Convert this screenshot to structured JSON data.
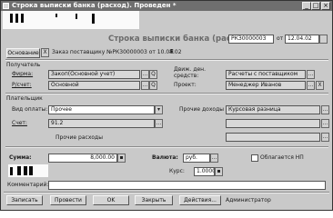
{
  "window": {
    "title": "Строка выписки банка (расход). Проведен *",
    "buttons": {
      "minimize": "_",
      "maximize": "□",
      "close": "×"
    }
  },
  "header": {
    "doc_heading": "Строка выписки банка (расход) №",
    "doc_number": "РКЗ0000003",
    "date_prefix": "от",
    "date": "12.04.02"
  },
  "basis": {
    "button_label": "Основание",
    "x_label": "X",
    "text": "Заказ поставщику №РК30000003 от  10.04.02"
  },
  "recipient": {
    "section_label": "Получатель",
    "firm_label": "Фирма:",
    "firm_value": "Закоп(Основной учет)",
    "account_label": "Р/счет:",
    "account_value": "Основной",
    "movement_label": "Движ. ден. средств:",
    "movement_value": "Расчеты с поставщиком",
    "project_label": "Проект:",
    "project_value": "Менеджер Иванов",
    "q_label": "Q",
    "dots": "..."
  },
  "payer": {
    "section_label": "Плательщик",
    "payment_type_label": "Вид оплаты:",
    "payment_type_value": "Прочее",
    "other_income_label": "Прочие доходы и расходы",
    "other_income_value": "Курсовая разница",
    "account_label": "Счет:",
    "account_value": "91.2",
    "other_expenses_label": "Прочие расходы"
  },
  "amount": {
    "sum_label": "Сумма:",
    "sum_value": "8,000.00",
    "currency_label": "Валюта:",
    "currency_value": "руб.",
    "taxable_label": "Облагается НП",
    "rate_label": "Курс:",
    "rate_value": "1.0000"
  },
  "comment": {
    "label": "Комментарий:",
    "value": ""
  },
  "footer": {
    "record": "Записать",
    "post": "Провести",
    "ok": "OK",
    "close": "Закрыть",
    "actions": "Действия...",
    "user": "Администратор"
  }
}
